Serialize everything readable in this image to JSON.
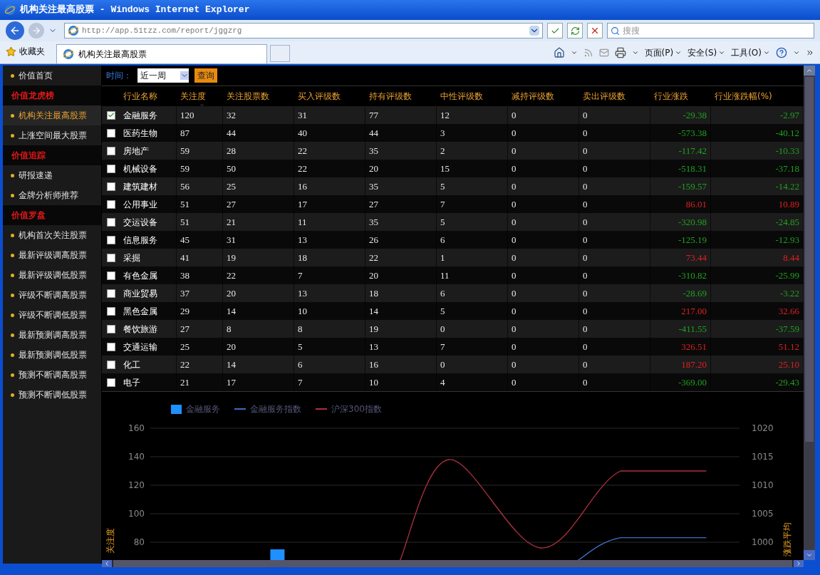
{
  "window": {
    "title": "机构关注最高股票 - Windows Internet Explorer"
  },
  "address_bar": {
    "url": "http://app.51tzz.com/report/jggzrg"
  },
  "search": {
    "placeholder": "搜搜"
  },
  "favorites": {
    "label": "收藏夹"
  },
  "tabs": [
    {
      "label": "机构关注最高股票",
      "selected": true
    }
  ],
  "command_bar": [
    "页面(P)",
    "安全(S)",
    "工具(O)"
  ],
  "sidebar": {
    "items": [
      {
        "kind": "link",
        "label": "价值首页",
        "selected": false
      },
      {
        "kind": "heading",
        "label": "价值龙虎榜"
      },
      {
        "kind": "link",
        "label": "机构关注最高股票",
        "selected": true
      },
      {
        "kind": "link",
        "label": "上涨空间最大股票",
        "selected": false
      },
      {
        "kind": "heading",
        "label": "价值追踪"
      },
      {
        "kind": "link",
        "label": "研报速递",
        "selected": false
      },
      {
        "kind": "link",
        "label": "金牌分析师推荐",
        "selected": false
      },
      {
        "kind": "heading",
        "label": "价值罗盘"
      },
      {
        "kind": "link",
        "label": "机构首次关注股票",
        "selected": false
      },
      {
        "kind": "link",
        "label": "最新评级调高股票",
        "selected": false
      },
      {
        "kind": "link",
        "label": "最新评级调低股票",
        "selected": false
      },
      {
        "kind": "link",
        "label": "评级不断调高股票",
        "selected": false
      },
      {
        "kind": "link",
        "label": "评级不断调低股票",
        "selected": false
      },
      {
        "kind": "link",
        "label": "最新预测调高股票",
        "selected": false
      },
      {
        "kind": "link",
        "label": "最新预测调低股票",
        "selected": false
      },
      {
        "kind": "link",
        "label": "预测不断调高股票",
        "selected": false
      },
      {
        "kind": "link",
        "label": "预测不断调低股票",
        "selected": false
      }
    ]
  },
  "filter": {
    "label": "时间：",
    "period": "近一周",
    "button": "查询"
  },
  "table": {
    "columns": [
      "行业名称",
      "关注度",
      "关注股票数",
      "买入评级数",
      "持有评级数",
      "中性评级数",
      "减持评级数",
      "卖出评级数",
      "行业涨跌",
      "行业涨跌幅(%)"
    ],
    "rows": [
      {
        "checked": true,
        "color": "#20a020",
        "cells": [
          "金融服务",
          "120",
          "32",
          "31",
          "77",
          "12",
          "0",
          "0",
          "-29.38",
          "-2.97"
        ]
      },
      {
        "checked": false,
        "color": "#20a020",
        "cells": [
          "医药生物",
          "87",
          "44",
          "40",
          "44",
          "3",
          "0",
          "0",
          "-573.38",
          "-40.12"
        ]
      },
      {
        "checked": false,
        "color": "#20a020",
        "cells": [
          "房地产",
          "59",
          "28",
          "22",
          "35",
          "2",
          "0",
          "0",
          "-117.42",
          "-10.33"
        ]
      },
      {
        "checked": false,
        "color": "#20a020",
        "cells": [
          "机械设备",
          "59",
          "50",
          "22",
          "20",
          "15",
          "0",
          "0",
          "-518.31",
          "-37.18"
        ]
      },
      {
        "checked": false,
        "color": "#20a020",
        "cells": [
          "建筑建材",
          "56",
          "25",
          "16",
          "35",
          "5",
          "0",
          "0",
          "-159.57",
          "-14.22"
        ]
      },
      {
        "checked": false,
        "color": "#e02020",
        "cells": [
          "公用事业",
          "51",
          "27",
          "17",
          "27",
          "7",
          "0",
          "0",
          "86.01",
          "10.89"
        ]
      },
      {
        "checked": false,
        "color": "#20a020",
        "cells": [
          "交运设备",
          "51",
          "21",
          "11",
          "35",
          "5",
          "0",
          "0",
          "-320.98",
          "-24.85"
        ]
      },
      {
        "checked": false,
        "color": "#20a020",
        "cells": [
          "信息服务",
          "45",
          "31",
          "13",
          "26",
          "6",
          "0",
          "0",
          "-125.19",
          "-12.93"
        ]
      },
      {
        "checked": false,
        "color": "#e02020",
        "cells": [
          "采掘",
          "41",
          "19",
          "18",
          "22",
          "1",
          "0",
          "0",
          "73.44",
          "8.44"
        ]
      },
      {
        "checked": false,
        "color": "#20a020",
        "cells": [
          "有色金属",
          "38",
          "22",
          "7",
          "20",
          "11",
          "0",
          "0",
          "-310.82",
          "-25.99"
        ]
      },
      {
        "checked": false,
        "color": "#20a020",
        "cells": [
          "商业贸易",
          "37",
          "20",
          "13",
          "18",
          "6",
          "0",
          "0",
          "-28.69",
          "-3.22"
        ]
      },
      {
        "checked": false,
        "color": "#e02020",
        "cells": [
          "黑色金属",
          "29",
          "14",
          "10",
          "14",
          "5",
          "0",
          "0",
          "217.00",
          "32.66"
        ]
      },
      {
        "checked": false,
        "color": "#20a020",
        "cells": [
          "餐饮旅游",
          "27",
          "8",
          "8",
          "19",
          "0",
          "0",
          "0",
          "-411.55",
          "-37.59"
        ]
      },
      {
        "checked": false,
        "color": "#e02020",
        "cells": [
          "交通运输",
          "25",
          "20",
          "5",
          "13",
          "7",
          "0",
          "0",
          "326.51",
          "51.12"
        ]
      },
      {
        "checked": false,
        "color": "#e02020",
        "cells": [
          "化工",
          "22",
          "14",
          "6",
          "16",
          "0",
          "0",
          "0",
          "187.20",
          "25.10"
        ]
      },
      {
        "checked": false,
        "color": "#20a020",
        "cells": [
          "电子",
          "21",
          "17",
          "7",
          "10",
          "4",
          "0",
          "0",
          "-369.00",
          "-29.43"
        ]
      }
    ]
  },
  "chart": {
    "legend": [
      {
        "kind": "bar",
        "label": "金融服务",
        "color": "#1e90ff"
      },
      {
        "kind": "line",
        "label": "金融服务指数",
        "color": "#3a6fc4"
      },
      {
        "kind": "line",
        "label": "沪深300指数",
        "color": "#b03040"
      }
    ],
    "left_axis": {
      "title": "关注度",
      "ticks": [
        "160",
        "140",
        "120",
        "100",
        "80"
      ]
    },
    "right_axis": {
      "title": "涨跌平均",
      "ticks": [
        "1020",
        "1015",
        "1010",
        "1005",
        "1000"
      ]
    }
  }
}
